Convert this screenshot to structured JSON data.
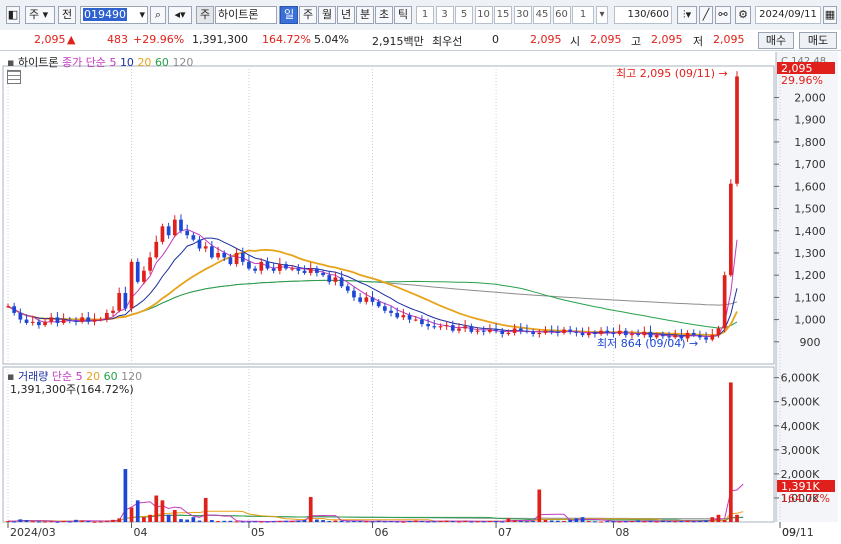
{
  "toolbar": {
    "market": "주",
    "prefix": "전",
    "code": "019490",
    "stock_type": "주",
    "stock_name": "하이트론",
    "periods": [
      "일",
      "주",
      "월",
      "년",
      "분",
      "초",
      "틱"
    ],
    "selected_period": "일",
    "intervals": [
      "1",
      "3",
      "5",
      "10",
      "15",
      "30",
      "45",
      "60"
    ],
    "interval_value": "1",
    "count": "130/600",
    "date": "2024/09/11"
  },
  "quote": {
    "price": "2,095",
    "change": "483",
    "change_pct": "+29.96%",
    "volume": "1,391,300",
    "volume_ratio": "164.72%",
    "turnover": "5.04%",
    "amount": "2,915백만",
    "preferred_label": "최우선",
    "preferred_value": "0",
    "ask": "2,095",
    "open_label": "시",
    "open": "2,095",
    "high_label": "고",
    "high": "2,095",
    "low_label": "저",
    "low": "2,095",
    "buy": "매수",
    "sell": "매도"
  },
  "price_legend": {
    "name": "하이트론",
    "ma_label": "종가 단순",
    "ma": [
      "5",
      "10",
      "20",
      "60",
      "120"
    ]
  },
  "volume_legend": {
    "title": "거래량",
    "ma_label": "단순",
    "ma": [
      "5",
      "20",
      "60",
      "120"
    ],
    "value": "1,391,300주(164.72%)"
  },
  "annotations": {
    "high": "최고 2,095 (09/11)",
    "low": "최저 864 (09/04)"
  },
  "colors": {
    "up": "#e0201b",
    "down": "#1f47d6",
    "ma5": "#c23bc2",
    "ma10": "#1c2f9e",
    "ma20": "#e8a31a",
    "ma60": "#27a04a",
    "ma120": "#8c8c8c"
  },
  "chart_data": [
    {
      "type": "candlestick",
      "title": "하이트론",
      "y_ticks": [
        "900",
        "1,000",
        "1,100",
        "1,200",
        "1,300",
        "1,400",
        "1,500",
        "1,600",
        "1,700",
        "1,800",
        "1,900",
        "2,000"
      ],
      "ylim": [
        800,
        2142
      ],
      "top_label": "C 142.48",
      "current_price": "2,095",
      "current_pct": "29.96%",
      "x_ticks": [
        "2024/03",
        "04",
        "05",
        "06",
        "07",
        "08",
        "09",
        "09/11"
      ],
      "close": [
        1060,
        1030,
        1000,
        985,
        990,
        975,
        990,
        1010,
        985,
        1000,
        995,
        990,
        1010,
        990,
        1000,
        1000,
        1030,
        1040,
        1120,
        1050,
        1260,
        1170,
        1220,
        1280,
        1350,
        1420,
        1380,
        1450,
        1400,
        1380,
        1360,
        1320,
        1330,
        1280,
        1300,
        1280,
        1250,
        1300,
        1260,
        1230,
        1220,
        1260,
        1230,
        1220,
        1250,
        1230,
        1230,
        1220,
        1210,
        1230,
        1210,
        1200,
        1170,
        1190,
        1150,
        1130,
        1100,
        1080,
        1100,
        1080,
        1060,
        1040,
        1030,
        1010,
        1020,
        1000,
        1000,
        980,
        970,
        965,
        970,
        975,
        950,
        960,
        970,
        945,
        950,
        945,
        955,
        950,
        935,
        940,
        960,
        950,
        945,
        935,
        940,
        950,
        945,
        940,
        955,
        945,
        940,
        930,
        940,
        935,
        950,
        940,
        935,
        950,
        930,
        935,
        930,
        945,
        920,
        930,
        925,
        920,
        930,
        915,
        940,
        930,
        920,
        910,
        930,
        960,
        1200,
        1612,
        2095
      ],
      "volume_k": [
        40,
        20,
        110,
        80,
        30,
        20,
        20,
        30,
        10,
        40,
        20,
        90,
        60,
        40,
        10,
        20,
        60,
        90,
        150,
        2200,
        600,
        900,
        200,
        300,
        1100,
        900,
        300,
        500,
        120,
        100,
        200,
        60,
        1000,
        80,
        40,
        50,
        50,
        30,
        20,
        20,
        30,
        20,
        20,
        30,
        40,
        50,
        40,
        60,
        80,
        1040,
        100,
        80,
        40,
        60,
        50,
        30,
        40,
        40,
        30,
        20,
        50,
        30,
        40,
        20,
        10,
        40,
        60,
        40,
        20,
        30,
        40,
        60,
        40,
        20,
        50,
        20,
        30,
        30,
        40,
        40,
        20,
        150,
        60,
        40,
        30,
        40,
        1350,
        90,
        60,
        50,
        40,
        100,
        150,
        200,
        40,
        30,
        20,
        40,
        30,
        20,
        30,
        40,
        60,
        30,
        40,
        20,
        60,
        40,
        30,
        40,
        50,
        30,
        40,
        60,
        200,
        300,
        80,
        5800,
        300,
        1391
      ],
      "volume_y_ticks": [
        "1,000K",
        "2,000K",
        "3,000K",
        "4,000K",
        "5,000K",
        "6,000K"
      ],
      "current_volume": "1,391K",
      "volume_ratio": "164.72%"
    }
  ]
}
